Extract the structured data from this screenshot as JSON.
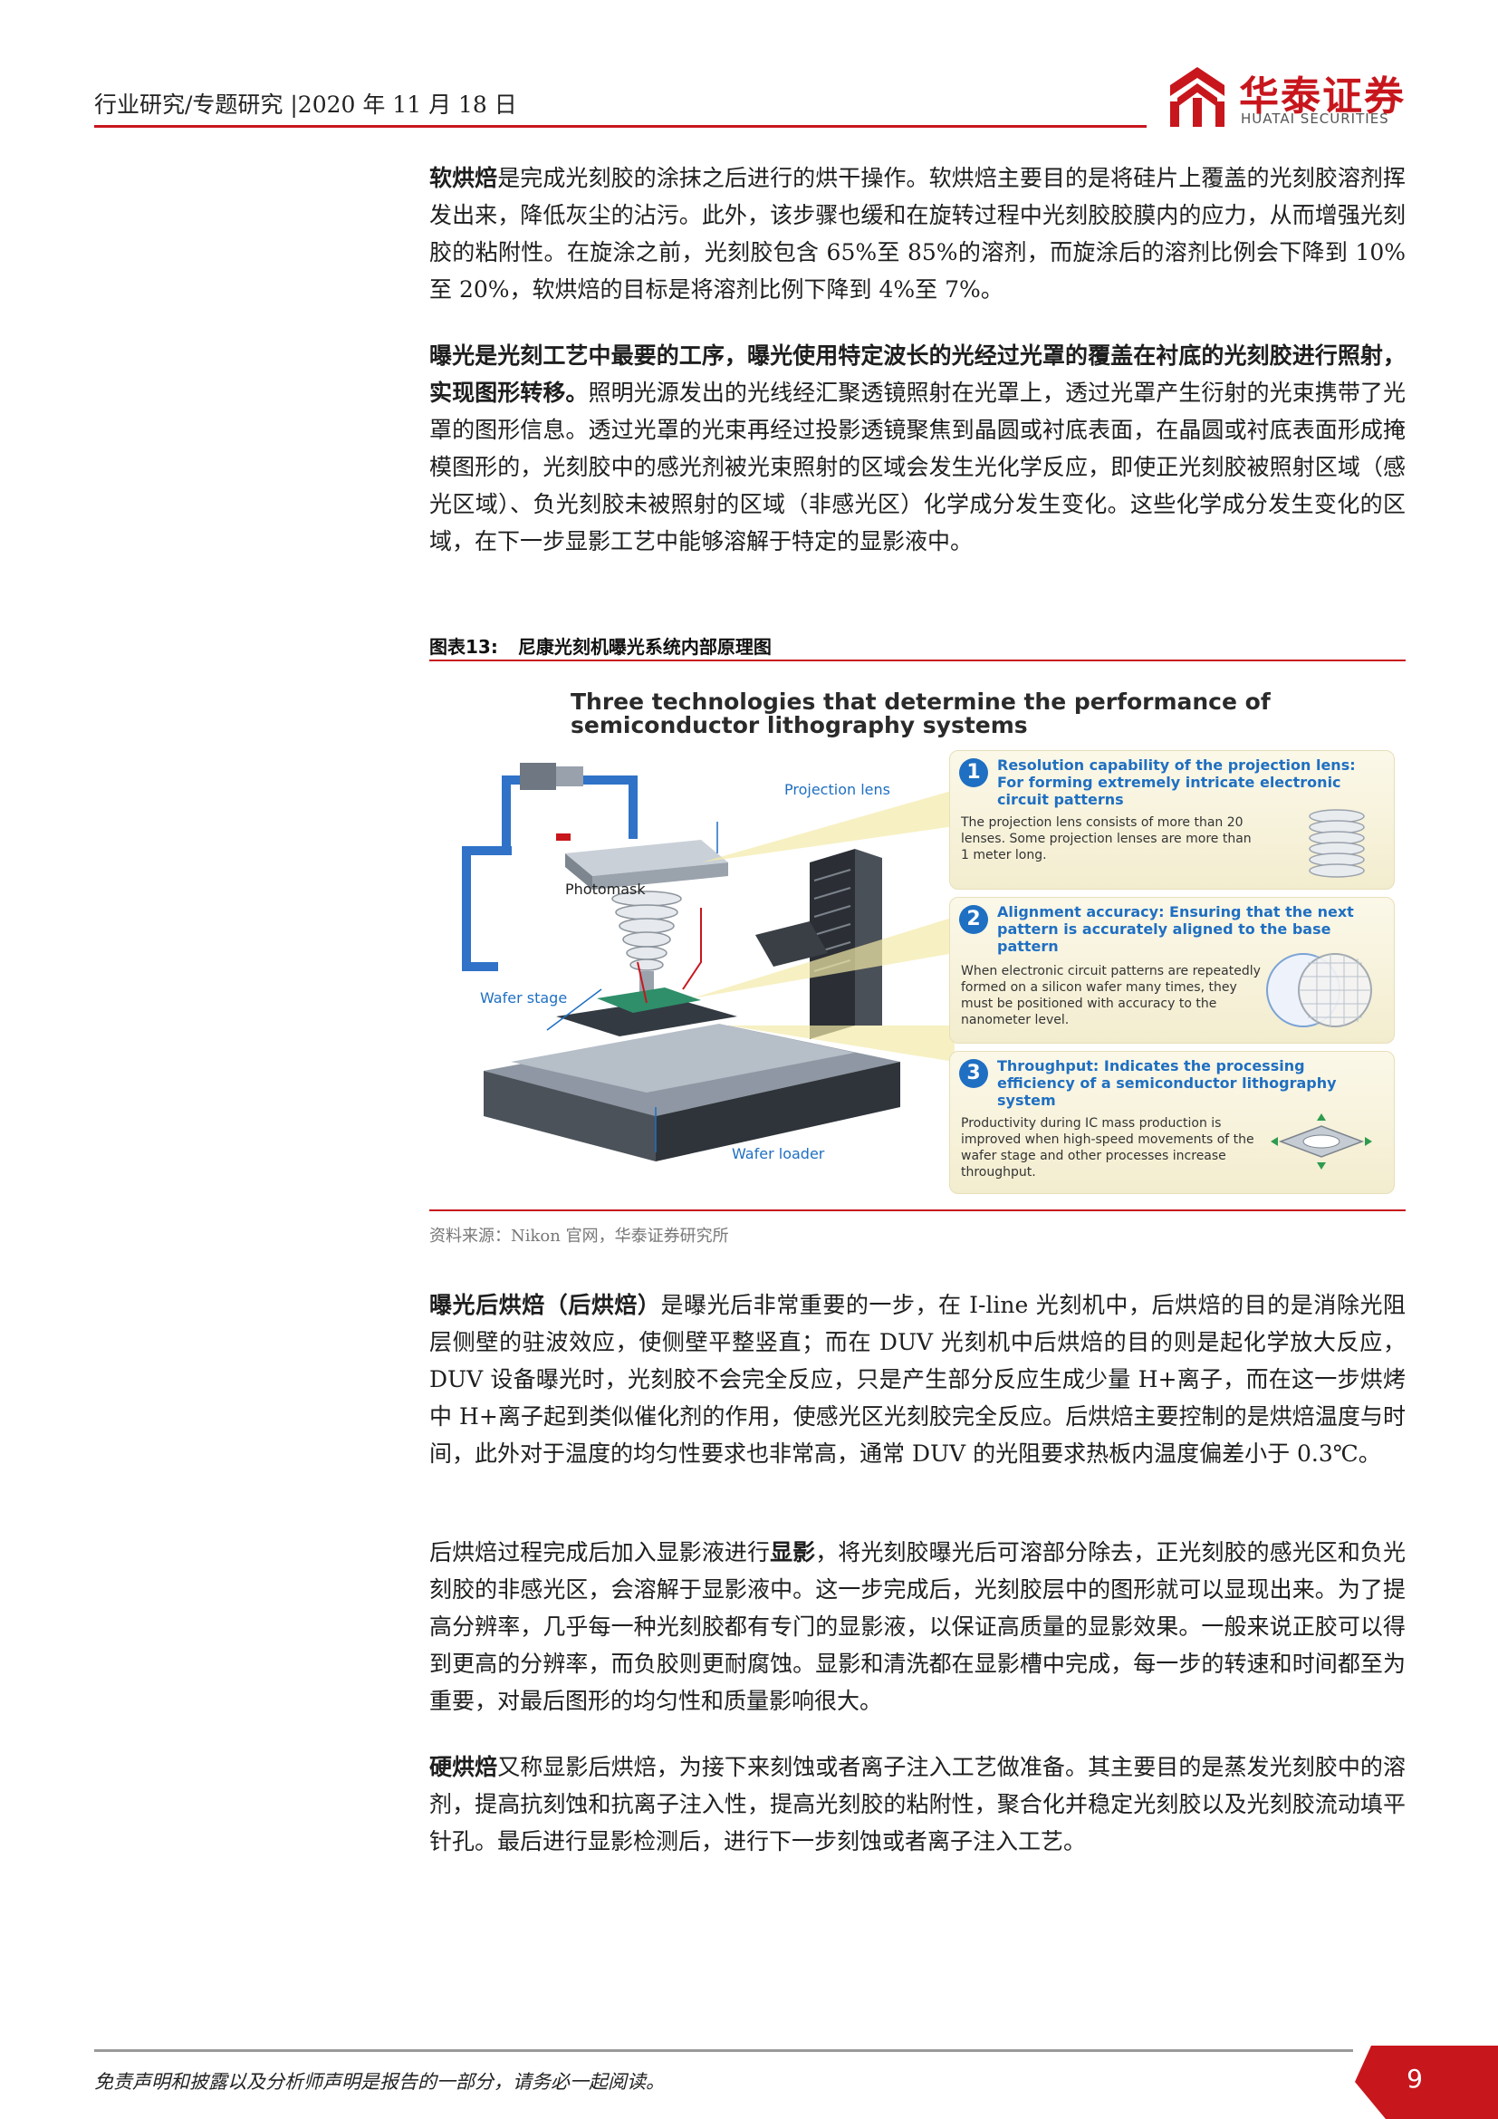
{
  "header": {
    "text": "行业研究/专题研究 |2020 年 11 月 18 日",
    "logo_name": "华泰证券",
    "logo_en": "HUATAI SECURITIES"
  },
  "paragraphs": {
    "p1_bold": "软烘焙",
    "p1_rest": "是完成光刻胶的涂抹之后进行的烘干操作。软烘焙主要目的是将硅片上覆盖的光刻胶溶剂挥发出来，降低灰尘的沾污。此外，该步骤也缓和在旋转过程中光刻胶胶膜内的应力，从而增强光刻胶的粘附性。在旋涂之前，光刻胶包含 65%至 85%的溶剂，而旋涂后的溶剂比例会下降到 10%至 20%，软烘焙的目标是将溶剂比例下降到 4%至 7%。",
    "p2_bold": "曝光是光刻工艺中最要的工序，曝光使用特定波长的光经过光罩的覆盖在衬底的光刻胶进行照射，实现图形转移。",
    "p2_rest": "照明光源发出的光线经汇聚透镜照射在光罩上，透过光罩产生衍射的光束携带了光罩的图形信息。透过光罩的光束再经过投影透镜聚焦到晶圆或衬底表面，在晶圆或衬底表面形成掩模图形的，光刻胶中的感光剂被光束照射的区域会发生光化学反应，即使正光刻胶被照射区域（感光区域）、负光刻胶未被照射的区域（非感光区）化学成分发生变化。这些化学成分发生变化的区域，在下一步显影工艺中能够溶解于特定的显影液中。",
    "p3_bold": "曝光后烘焙（后烘焙）",
    "p3_rest": "是曝光后非常重要的一步，在 I-line 光刻机中，后烘焙的目的是消除光阻层侧壁的驻波效应，使侧壁平整竖直；而在 DUV 光刻机中后烘焙的目的则是起化学放大反应，DUV 设备曝光时，光刻胶不会完全反应，只是产生部分反应生成少量 H+离子，而在这一步烘烤中 H+离子起到类似催化剂的作用，使感光区光刻胶完全反应。后烘焙主要控制的是烘焙温度与时间，此外对于温度的均匀性要求也非常高，通常 DUV 的光阻要求热板内温度偏差小于 0.3℃。",
    "p4_pre": "后烘焙过程完成后加入显影液进行",
    "p4_bold": "显影",
    "p4_rest": "，将光刻胶曝光后可溶部分除去，正光刻胶的感光区和负光刻胶的非感光区，会溶解于显影液中。这一步完成后，光刻胶层中的图形就可以显现出来。为了提高分辨率，几乎每一种光刻胶都有专门的显影液，以保证高质量的显影效果。一般来说正胶可以得到更高的分辨率，而负胶则更耐腐蚀。显影和清洗都在显影槽中完成，每一步的转速和时间都至为重要，对最后图形的均匀性和质量影响很大。",
    "p5_bold": "硬烘焙",
    "p5_rest": "又称显影后烘焙，为接下来刻蚀或者离子注入工艺做准备。其主要目的是蒸发光刻胶中的溶剂，提高抗刻蚀和抗离子注入性，提高光刻胶的粘附性，聚合化并稳定光刻胶以及光刻胶流动填平针孔。最后进行显影检测后，进行下一步刻蚀或者离子注入工艺。"
  },
  "figure": {
    "caption_num": "图表13:",
    "caption_text": "尼康光刻机曝光系统内部原理图",
    "title_line1": "Three technologies that determine the performance of",
    "title_line2": "semiconductor lithography systems",
    "labels": {
      "projection_lens": "Projection lens",
      "photomask": "Photomask",
      "wafer_stage": "Wafer stage",
      "wafer_loader": "Wafer loader"
    },
    "panels": [
      {
        "num": "1",
        "title": "Resolution capability of the projection lens: For forming extremely intricate electronic circuit patterns",
        "body": "The projection lens consists of more than 20 lenses. Some projection lenses are more than 1 meter long."
      },
      {
        "num": "2",
        "title": "Alignment accuracy: Ensuring that the next pattern is accurately aligned to the base pattern",
        "body": "When electronic circuit patterns are repeatedly formed on a silicon wafer many times, they must be positioned with accuracy to the nanometer level."
      },
      {
        "num": "3",
        "title": "Throughput: Indicates the processing efficiency of a semiconductor lithography system",
        "body": "Productivity during IC mass production is improved when high-speed movements of the wafer stage and other processes increase throughput."
      }
    ],
    "source": "资料来源：Nikon 官网，华泰证券研究所"
  },
  "footer": {
    "disclaimer": "免责声明和披露以及分析师声明是报告的一部分，请务必一起阅读。",
    "page": "9"
  },
  "colors": {
    "brand_red": "#c8161d",
    "diagram_blue": "#1f6fc2"
  }
}
